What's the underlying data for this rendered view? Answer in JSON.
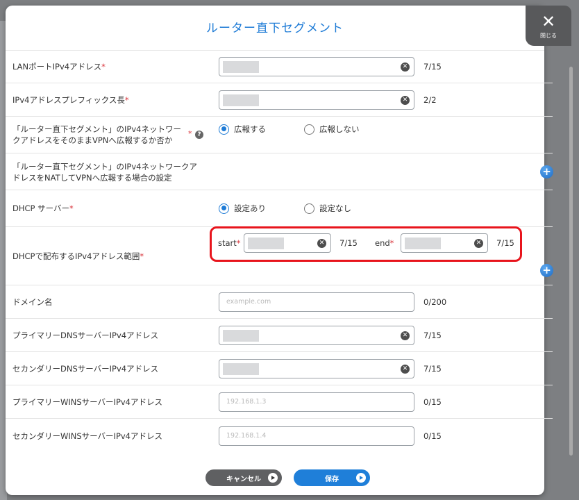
{
  "modal": {
    "title": "ルーター直下セグメント",
    "close_label": "閉じる",
    "close_glyph": "✕"
  },
  "fields": {
    "lan_port": {
      "label": "LANポートIPv4アドレス",
      "required": "*",
      "counter": "7/15"
    },
    "prefix": {
      "label": "IPv4アドレスプレフィックス長",
      "required": "*",
      "counter": "2/2"
    },
    "advertise": {
      "label_line1": "「ルーター直下セグメント」のIPv4ネットワー",
      "label_line2": "クアドレスをそのままVPNへ広報するか否か",
      "required": "*",
      "help_glyph": "?",
      "option_yes": "広報する",
      "option_no": "広報しない",
      "selected": "広報する"
    },
    "nat": {
      "label_line1": "「ルーター直下セグメント」のIPv4ネットワークア",
      "label_line2": "ドレスをNATしてVPNへ広報する場合の設定",
      "add_glyph": "+"
    },
    "dhcp_server": {
      "label": "DHCP サーバー",
      "required": "*",
      "option_on": "設定あり",
      "option_off": "設定なし",
      "selected": "設定あり"
    },
    "dhcp_range": {
      "label": "DHCPで配布するIPv4アドレス範囲",
      "required": "*",
      "start_label": "start",
      "end_label": "end",
      "start_counter": "7/15",
      "end_counter": "7/15",
      "add_glyph": "+"
    },
    "domain": {
      "label": "ドメイン名",
      "placeholder": "example.com",
      "counter": "0/200"
    },
    "primary_dns": {
      "label": "プライマリーDNSサーバーIPv4アドレス",
      "counter": "7/15"
    },
    "secondary_dns": {
      "label": "セカンダリーDNSサーバーIPv4アドレス",
      "counter": "7/15"
    },
    "primary_wins": {
      "label": "プライマリーWINSサーバーIPv4アドレス",
      "placeholder": "192.168.1.3",
      "counter": "0/15"
    },
    "secondary_wins": {
      "label": "セカンダリーWINSサーバーIPv4アドレス",
      "placeholder": "192.168.1.4",
      "counter": "0/15"
    }
  },
  "clear_glyph": "✕",
  "footer": {
    "cancel_label": "キャンセル",
    "save_label": "保存"
  },
  "colors": {
    "accent": "#1e7bd6",
    "required": "#d9343b",
    "highlight": "#e8141c",
    "cancel": "#5f6062"
  },
  "icons": [
    "close-icon",
    "clear-icon",
    "help-icon",
    "add-icon",
    "play-icon"
  ]
}
